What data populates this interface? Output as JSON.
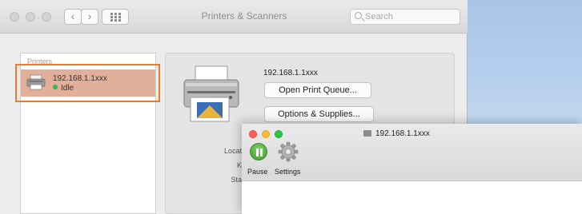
{
  "window": {
    "title": "Printers & Scanners",
    "search_placeholder": "Search",
    "back_glyph": "‹",
    "forward_glyph": "›"
  },
  "sidebar": {
    "heading": "Printers",
    "items": [
      {
        "name": "192.168.1.1xxx",
        "status": "Idle",
        "status_color": "#35b44a",
        "selected": true
      }
    ]
  },
  "detail": {
    "printer_name": "192.168.1.1xxx",
    "open_queue_label": "Open Print Queue...",
    "options_label": "Options & Supplies...",
    "fields": [
      "Locat",
      "K",
      "Sta"
    ]
  },
  "queue_window": {
    "title": "192.168.1.1xxx",
    "pause_label": "Pause",
    "settings_label": "Settings"
  },
  "icons": {
    "printer": "printer-icon",
    "gear": "gear-icon",
    "pause": "pause-icon",
    "search": "search-icon"
  },
  "colors": {
    "highlight": "#ee7a2a",
    "selection": "#e2b09a",
    "traffic_red": "#ff5f57",
    "traffic_yellow": "#febc2e",
    "traffic_green": "#28c840"
  }
}
